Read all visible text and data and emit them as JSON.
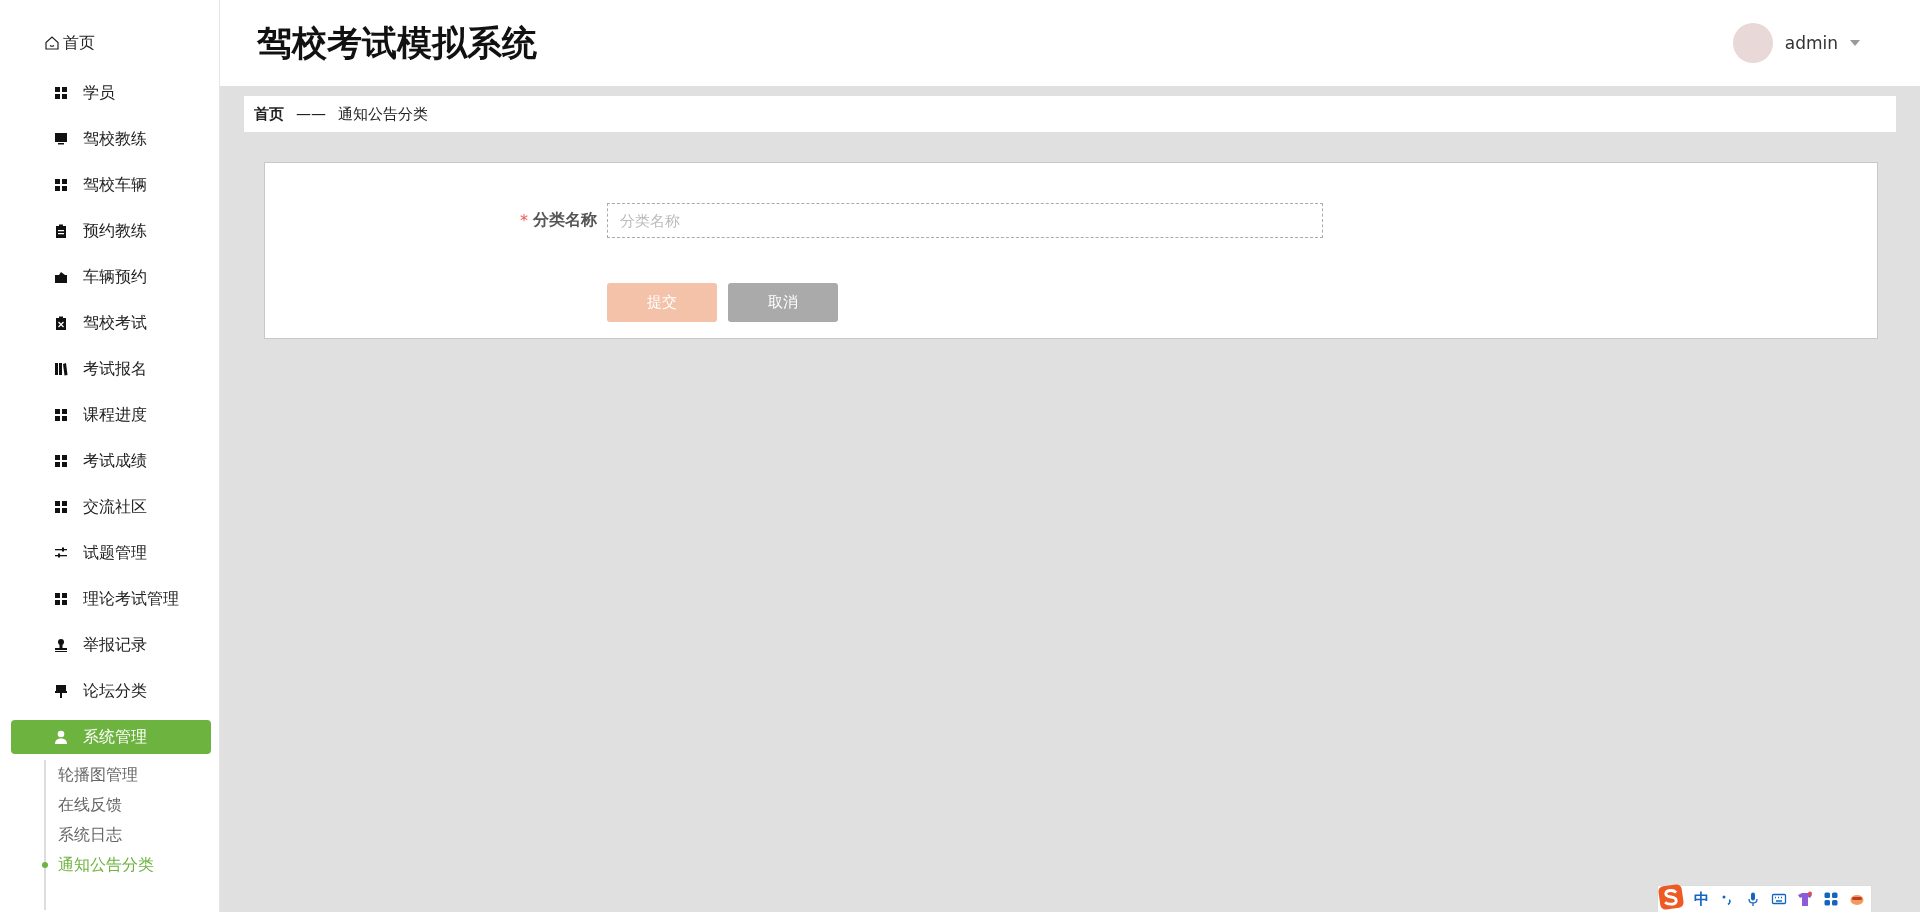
{
  "sidebar": {
    "home": {
      "label": "首页"
    },
    "items": [
      {
        "label": "学员",
        "selected": false
      },
      {
        "label": "驾校教练",
        "selected": false
      },
      {
        "label": "驾校车辆",
        "selected": false
      },
      {
        "label": "预约教练",
        "selected": false
      },
      {
        "label": "车辆预约",
        "selected": false
      },
      {
        "label": "驾校考试",
        "selected": false
      },
      {
        "label": "考试报名",
        "selected": false
      },
      {
        "label": "课程进度",
        "selected": false
      },
      {
        "label": "考试成绩",
        "selected": false
      },
      {
        "label": "交流社区",
        "selected": false
      },
      {
        "label": "试题管理",
        "selected": false
      },
      {
        "label": "理论考试管理",
        "selected": false
      },
      {
        "label": "举报记录",
        "selected": false
      },
      {
        "label": "论坛分类",
        "selected": false
      },
      {
        "label": "系统管理",
        "selected": true,
        "expanded": true,
        "children": [
          {
            "label": "轮播图管理",
            "selected": false
          },
          {
            "label": "在线反馈",
            "selected": false
          },
          {
            "label": "系统日志",
            "selected": false
          },
          {
            "label": "通知公告分类",
            "selected": true
          }
        ]
      }
    ]
  },
  "header": {
    "title": "驾校考试模拟系统",
    "user": "admin"
  },
  "breadcrumb": {
    "home": "首页",
    "separator": "——",
    "current": "通知公告分类"
  },
  "form": {
    "fields": [
      {
        "label": "分类名称",
        "required_mark": "*",
        "placeholder": "分类名称"
      }
    ],
    "buttons": [
      {
        "label": "提交",
        "kind": "primary",
        "disabled": true
      },
      {
        "label": "取消",
        "kind": "cancel",
        "disabled": false
      }
    ]
  },
  "ime_toolbar": {
    "mode": "中"
  }
}
